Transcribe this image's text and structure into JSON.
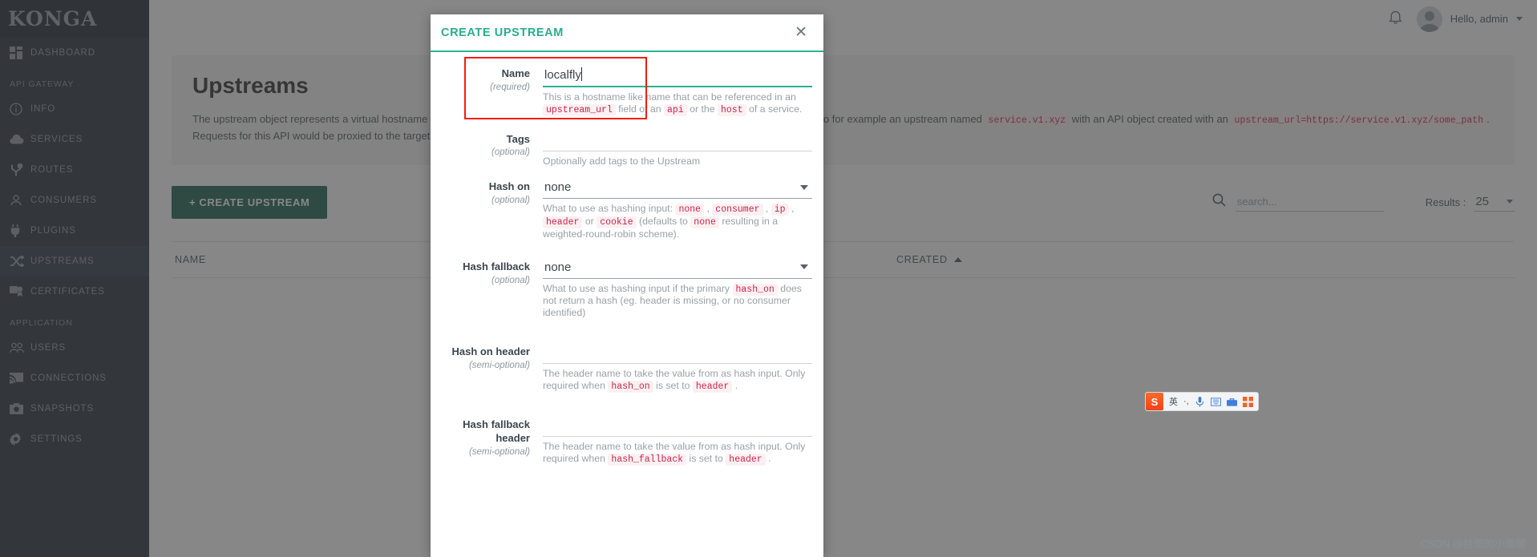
{
  "brand": {
    "name": "KONGA"
  },
  "sidebar": {
    "groups": [
      {
        "label": "",
        "items": [
          {
            "label": "DASHBOARD",
            "icon": "dashboard-icon",
            "active": false
          }
        ]
      },
      {
        "label": "API GATEWAY",
        "items": [
          {
            "label": "INFO",
            "icon": "info-icon",
            "active": false
          },
          {
            "label": "SERVICES",
            "icon": "cloud-icon",
            "active": false
          },
          {
            "label": "ROUTES",
            "icon": "routes-icon",
            "active": false
          },
          {
            "label": "CONSUMERS",
            "icon": "person-icon",
            "active": false
          },
          {
            "label": "PLUGINS",
            "icon": "plug-icon",
            "active": false
          },
          {
            "label": "UPSTREAMS",
            "icon": "shuffle-icon",
            "active": true
          },
          {
            "label": "CERTIFICATES",
            "icon": "certificate-icon",
            "active": false
          }
        ]
      },
      {
        "label": "APPLICATION",
        "items": [
          {
            "label": "USERS",
            "icon": "users-icon",
            "active": false
          },
          {
            "label": "CONNECTIONS",
            "icon": "connections-icon",
            "active": false
          },
          {
            "label": "SNAPSHOTS",
            "icon": "camera-icon",
            "active": false
          },
          {
            "label": "SETTINGS",
            "icon": "gear-icon",
            "active": false
          }
        ]
      }
    ]
  },
  "topbar": {
    "notifications_icon": "bell-icon",
    "user_greeting": "Hello, admin"
  },
  "page": {
    "title": "Upstreams",
    "description_part1": "The upstream object represents a virtual hostname and can be used to loadbalance incoming requests over multiple services (targets). So for example an upstream named",
    "description_code1": "service.v1.xyz",
    "description_part2": "with an API object created with an",
    "description_code2": "upstream_url=https://service.v1.xyz/some_path",
    "description_part3": ". Requests for this API would be proxied to the targets defined within the upstream.",
    "create_button": "+  CREATE UPSTREAM",
    "search_placeholder": "search...",
    "search_value": "",
    "results_label": "Results :",
    "results_value": "25",
    "table_columns": [
      "NAME",
      "CREATED"
    ]
  },
  "modal": {
    "title": "CREATE UPSTREAM",
    "close_icon": "close-icon",
    "fields": [
      {
        "label": "Name",
        "requirement": "(required)",
        "type": "text",
        "value": "localfly",
        "focused": true,
        "hint_segments": [
          {
            "t": "This is a hostname like name that can be referenced in an ",
            "code": false
          },
          {
            "t": "upstream_url",
            "code": true
          },
          {
            "t": " field of an ",
            "code": false
          },
          {
            "t": "api",
            "code": true
          },
          {
            "t": " or the ",
            "code": false
          },
          {
            "t": "host",
            "code": true
          },
          {
            "t": " of a service.",
            "code": false
          }
        ]
      },
      {
        "label": "Tags",
        "requirement": "(optional)",
        "type": "blank",
        "value": "",
        "focused": false,
        "hint_segments": [
          {
            "t": "Optionally add tags to the Upstream",
            "code": false
          }
        ]
      },
      {
        "label": "Hash on",
        "requirement": "(optional)",
        "type": "select",
        "value": "none",
        "focused": false,
        "hint_segments": [
          {
            "t": "What to use as hashing input: ",
            "code": false
          },
          {
            "t": "none",
            "code": true
          },
          {
            "t": " , ",
            "code": false
          },
          {
            "t": "consumer",
            "code": true
          },
          {
            "t": " , ",
            "code": false
          },
          {
            "t": "ip",
            "code": true
          },
          {
            "t": " , ",
            "code": false
          },
          {
            "t": "header",
            "code": true
          },
          {
            "t": " or ",
            "code": false
          },
          {
            "t": "cookie",
            "code": true
          },
          {
            "t": " (defaults to ",
            "code": false
          },
          {
            "t": "none",
            "code": true
          },
          {
            "t": " resulting in a weighted-round-robin scheme).",
            "code": false
          }
        ]
      },
      {
        "label": "Hash fallback",
        "requirement": "(optional)",
        "type": "select",
        "value": "none",
        "focused": false,
        "hint_segments": [
          {
            "t": "What to use as hashing input if the primary ",
            "code": false
          },
          {
            "t": "hash_on",
            "code": true
          },
          {
            "t": " does not return a hash (eg. header is missing, or no consumer identified)",
            "code": false
          }
        ]
      },
      {
        "label": "Hash on header",
        "requirement": "(semi-optional)",
        "type": "blank",
        "value": "",
        "focused": false,
        "hint_segments": [
          {
            "t": "The header name to take the value from as hash input. Only required when ",
            "code": false
          },
          {
            "t": "hash_on",
            "code": true
          },
          {
            "t": " is set to ",
            "code": false
          },
          {
            "t": "header",
            "code": true
          },
          {
            "t": " .",
            "code": false
          }
        ]
      },
      {
        "label": "Hash fallback header",
        "requirement": "(semi-optional)",
        "type": "blank",
        "value": "",
        "focused": false,
        "hint_segments": [
          {
            "t": "The header name to take the value from as hash input. Only required when ",
            "code": false
          },
          {
            "t": "hash_fallback",
            "code": true
          },
          {
            "t": " is set to ",
            "code": false
          },
          {
            "t": "header",
            "code": true
          },
          {
            "t": " .",
            "code": false
          }
        ]
      }
    ]
  },
  "ime": {
    "logo": "S",
    "mode": "英",
    "items": [
      "·,",
      "mic-icon",
      "keyboard-icon",
      "toolbox-icon",
      "apps-icon"
    ]
  },
  "watermark": {
    "text": "CSDN @拾荒的小海螺"
  },
  "colors": {
    "sidebar_bg": "#222d38",
    "sidebar_active": "#283544",
    "brand_bg": "#1b242d",
    "accent_green": "#2bb292",
    "button_green": "#17604a",
    "code_red": "#c7254e",
    "annotation_red": "#f71b06"
  }
}
